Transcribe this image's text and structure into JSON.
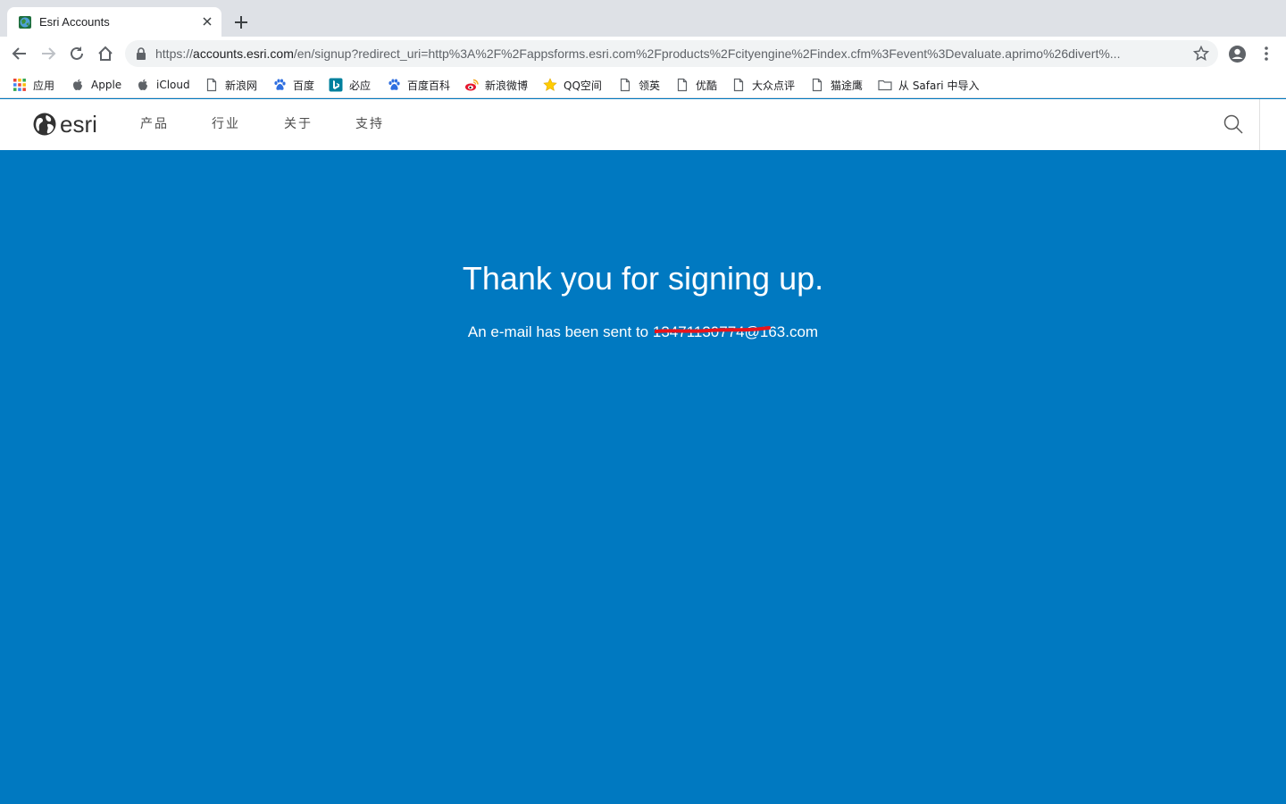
{
  "browser": {
    "tab": {
      "title": "Esri Accounts"
    },
    "address": {
      "scheme": "https://",
      "host": "accounts.esri.com",
      "path": "/en/signup?redirect_uri=http%3A%2F%2Fappsforms.esri.com%2Fproducts%2Fcityengine%2Findex.cfm%3Fevent%3Devaluate.aprimo%26divert%..."
    },
    "bookmarks": [
      {
        "label": "应用",
        "icon": "apps-grid-icon"
      },
      {
        "label": "Apple",
        "icon": "apple-icon"
      },
      {
        "label": "iCloud",
        "icon": "apple-icon"
      },
      {
        "label": "新浪网",
        "icon": "page-icon"
      },
      {
        "label": "百度",
        "icon": "baidu-paw-icon"
      },
      {
        "label": "必应",
        "icon": "bing-icon"
      },
      {
        "label": "百度百科",
        "icon": "baidu-paw-icon"
      },
      {
        "label": "新浪微博",
        "icon": "weibo-icon"
      },
      {
        "label": "QQ空间",
        "icon": "star-icon"
      },
      {
        "label": "领英",
        "icon": "page-icon"
      },
      {
        "label": "优酷",
        "icon": "page-icon"
      },
      {
        "label": "大众点评",
        "icon": "page-icon"
      },
      {
        "label": "猫途鹰",
        "icon": "page-icon"
      },
      {
        "label": "从 Safari 中导入",
        "icon": "folder-icon"
      }
    ]
  },
  "site": {
    "logo_text": "esri",
    "nav": [
      {
        "label": "产品"
      },
      {
        "label": "行业"
      },
      {
        "label": "关于"
      },
      {
        "label": "支持"
      }
    ]
  },
  "main": {
    "headline": "Thank you for signing up.",
    "sent_prefix": "An e-mail has been sent to ",
    "email_visible": "13471130774@163.com"
  },
  "colors": {
    "brand_blue": "#0079c1",
    "redaction_red": "#e8141c"
  }
}
